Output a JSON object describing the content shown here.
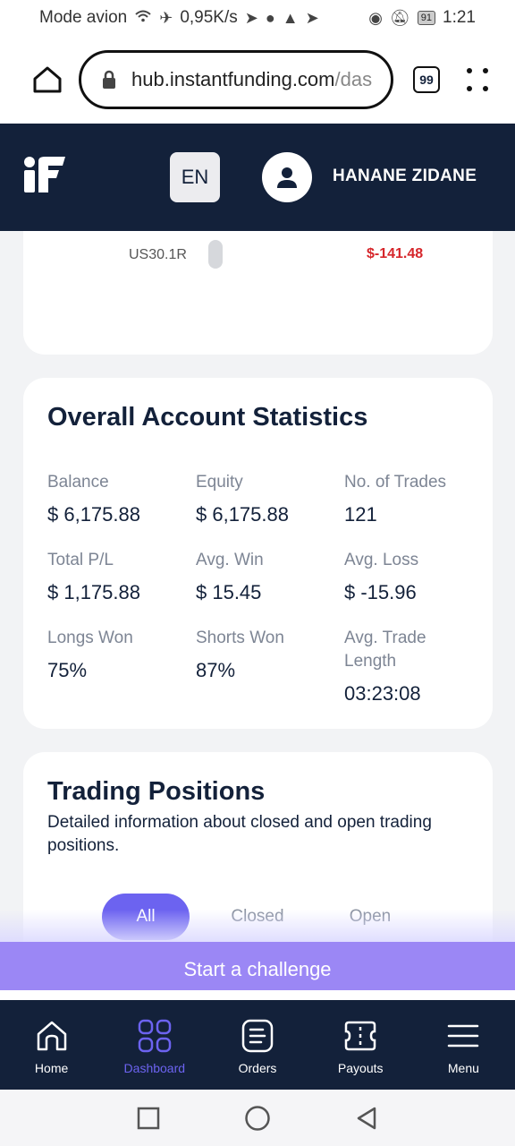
{
  "status_bar": {
    "left_text": "Mode avion",
    "speed": "0,95K/s",
    "battery": "91",
    "time": "1:21"
  },
  "browser": {
    "url_main": "hub.instantfunding.com",
    "url_rest": "/das",
    "tab_count": "99"
  },
  "header": {
    "language": "EN",
    "user_name": "HANANE ZIDANE"
  },
  "positions_partial": {
    "symbol": "US30.1R",
    "pnl": "$-141.48"
  },
  "stats": {
    "title": "Overall Account Statistics",
    "items": [
      {
        "label": "Balance",
        "value": "$ 6,175.88"
      },
      {
        "label": "Equity",
        "value": "$ 6,175.88"
      },
      {
        "label": "No. of Trades",
        "value": "121"
      },
      {
        "label": "Total P/L",
        "value": "$ 1,175.88"
      },
      {
        "label": "Avg. Win",
        "value": "$ 15.45"
      },
      {
        "label": "Avg. Loss",
        "value": "$ -15.96"
      },
      {
        "label": "Longs Won",
        "value": "75%"
      },
      {
        "label": "Shorts Won",
        "value": "87%"
      },
      {
        "label": "Avg. Trade Length",
        "value": "03:23:08"
      }
    ]
  },
  "trading_positions": {
    "title": "Trading Positions",
    "subtitle": "Detailed information about closed and open trading positions.",
    "filters": [
      "All",
      "Closed",
      "Open"
    ],
    "active_filter": "All"
  },
  "cta": {
    "label": "Start a challenge"
  },
  "bottom_nav": {
    "items": [
      {
        "label": "Home",
        "icon": "home-icon"
      },
      {
        "label": "Dashboard",
        "icon": "dashboard-icon"
      },
      {
        "label": "Orders",
        "icon": "orders-icon"
      },
      {
        "label": "Payouts",
        "icon": "payouts-icon"
      },
      {
        "label": "Menu",
        "icon": "menu-icon"
      }
    ],
    "active": "Dashboard"
  },
  "colors": {
    "navy": "#13213a",
    "accent": "#6c63f0",
    "cta": "#9b87f5",
    "negative": "#d6262b"
  }
}
